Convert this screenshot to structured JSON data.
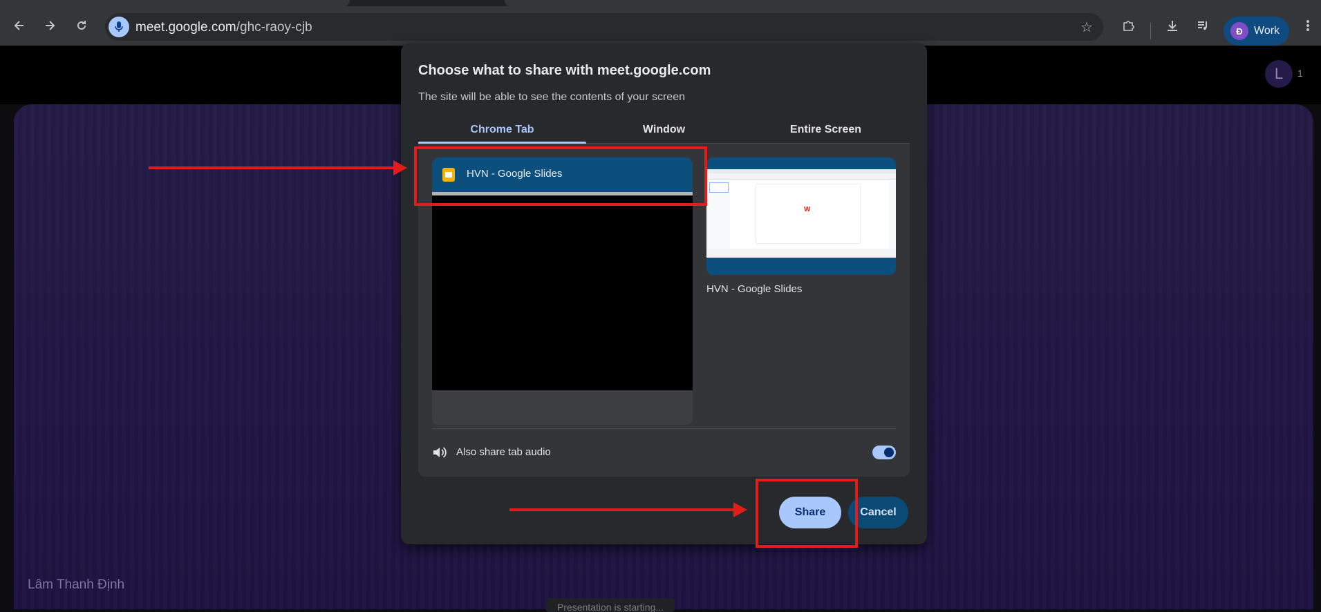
{
  "browser": {
    "url_host": "meet.google.com",
    "url_path": "/ghc-raoy-cjb",
    "profile_initial": "Đ",
    "profile_label": "Work",
    "icons": [
      "back-arrow-icon",
      "forward-arrow-icon",
      "reload-icon",
      "microphone-icon",
      "bookmark-star-icon",
      "extensions-icon",
      "download-icon",
      "media-control-icon",
      "more-vert-icon"
    ]
  },
  "meet": {
    "participant_initial": "L",
    "participant_count": "1",
    "user_name": "Lâm Thanh Định",
    "toast": "Presentation is starting..."
  },
  "dialog": {
    "title": "Choose what to share with meet.google.com",
    "subtitle": "The site will be able to see the contents of your screen",
    "tabs": [
      {
        "label": "Chrome Tab",
        "active": true
      },
      {
        "label": "Window",
        "active": false
      },
      {
        "label": "Entire Screen",
        "active": false
      }
    ],
    "tab_items": [
      {
        "title": "HVN - Google Slides",
        "selected": true
      },
      {
        "title": "HVN - Google Slides",
        "selected": false
      }
    ],
    "audio_label": "Also share tab audio",
    "audio_enabled": true,
    "share_label": "Share",
    "cancel_label": "Cancel"
  },
  "colors": {
    "accent": "#a8c7fa",
    "annotation": "#e21b1b",
    "dialog_bg": "#28292c",
    "stage_bg": "#221845"
  }
}
